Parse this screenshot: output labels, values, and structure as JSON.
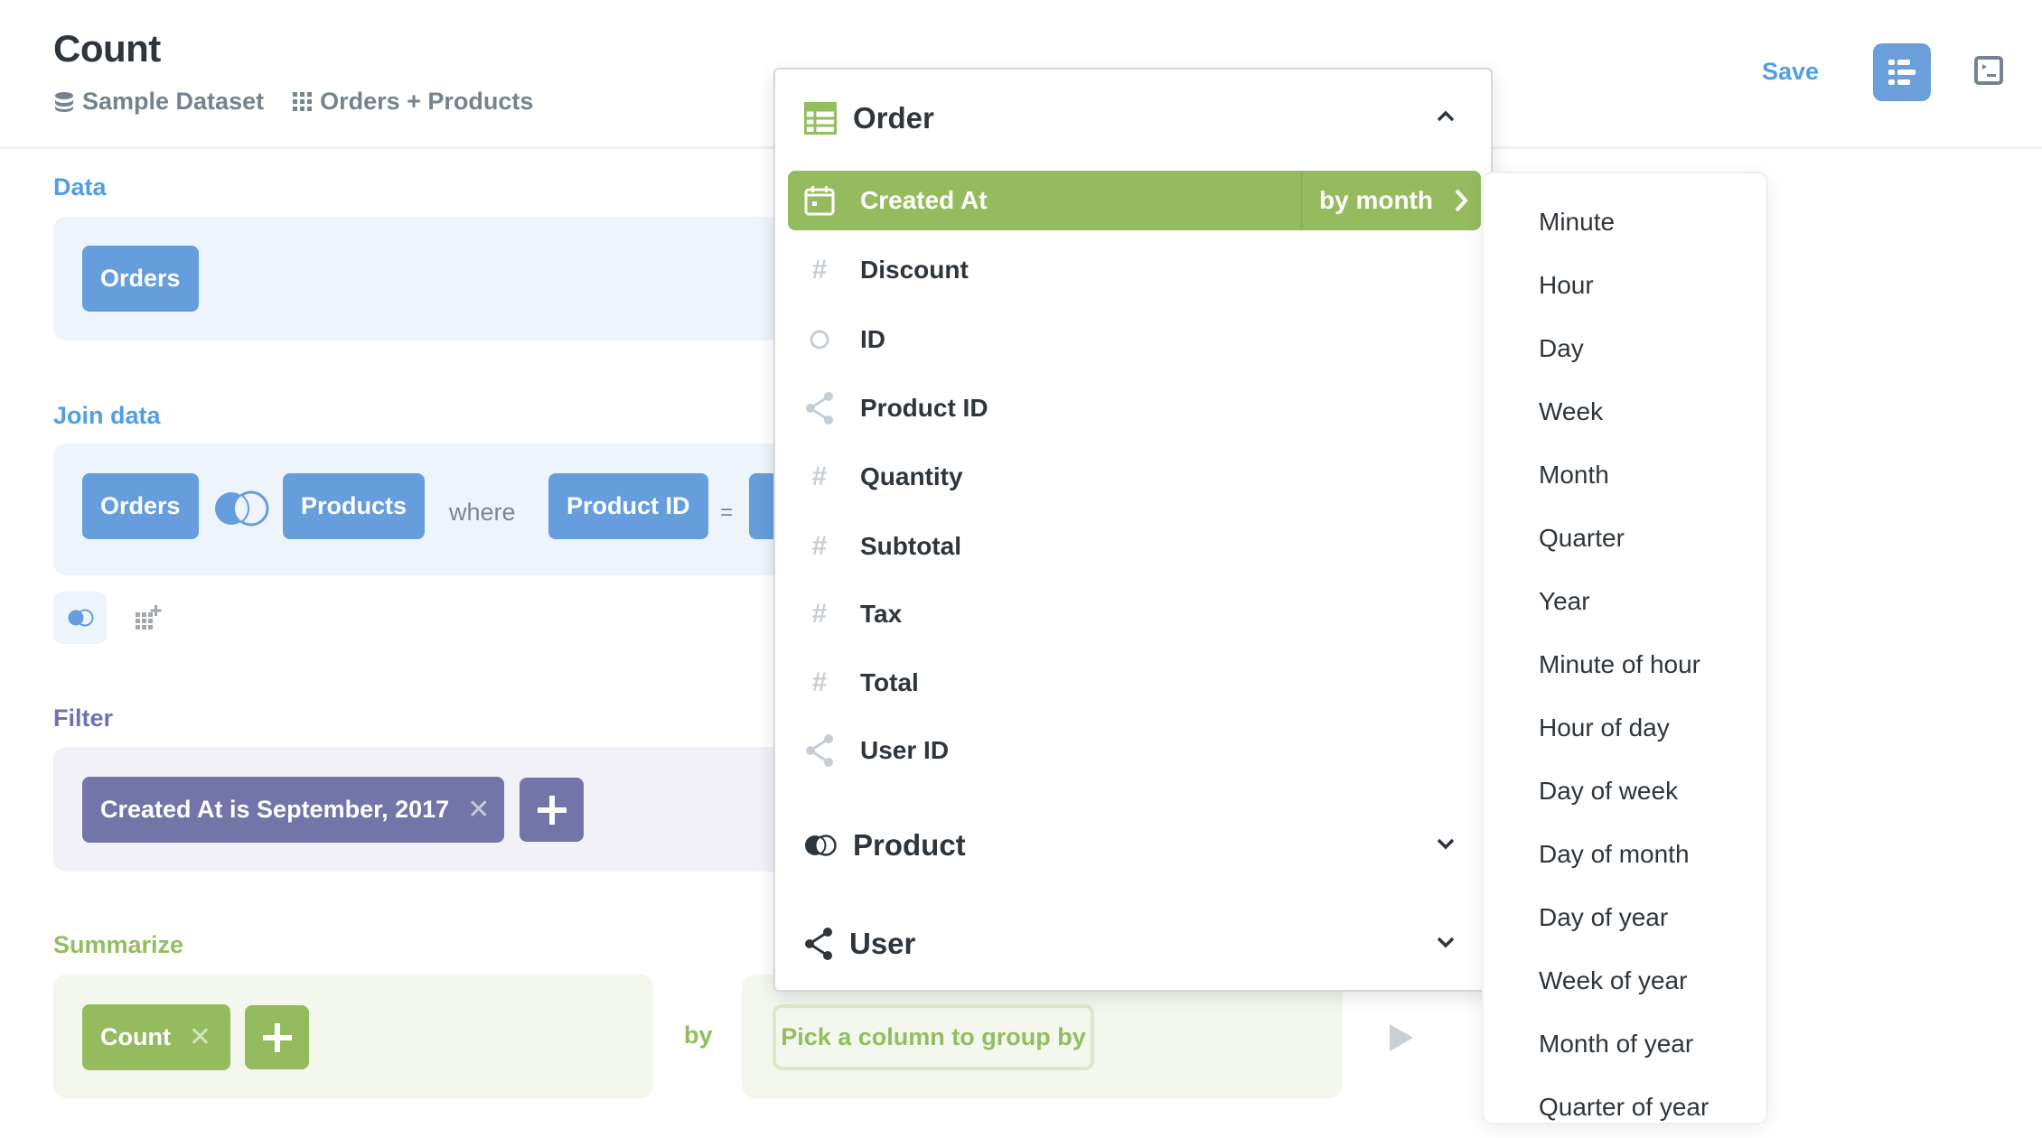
{
  "header": {
    "title": "Count",
    "database": "Sample Dataset",
    "table": "Orders + Products",
    "save_label": "Save",
    "icons": {
      "database": "database-icon",
      "table": "table-grid-icon",
      "notebook": "notebook-icon",
      "sql": "terminal-icon"
    }
  },
  "data_section": {
    "label": "Data",
    "source_table": "Orders"
  },
  "join_section": {
    "label": "Join data",
    "left_table": "Orders",
    "join_type_icon": "left-join-icon",
    "right_table": "Products",
    "where_text": "where",
    "left_column": "Product ID",
    "operator": "="
  },
  "filter_section": {
    "label": "Filter",
    "filters": [
      {
        "text": "Created At is September, 2017",
        "remove": "✕"
      }
    ],
    "add_icon": "plus-icon"
  },
  "summarize_section": {
    "label": "Summarize",
    "metrics": [
      {
        "text": "Count",
        "remove": "✕"
      }
    ],
    "by_text": "by",
    "group_placeholder": "Pick a column to group by"
  },
  "column_picker": {
    "sections": [
      {
        "name": "Order",
        "icon": "table-icon",
        "expanded": true,
        "columns": [
          {
            "name": "Created At",
            "icon": "calendar-icon",
            "selected": true,
            "bucket": "by month"
          },
          {
            "name": "Discount",
            "icon": "number-icon",
            "glyph": "#"
          },
          {
            "name": "ID",
            "icon": "id-icon"
          },
          {
            "name": "Product ID",
            "icon": "foreign-key-icon"
          },
          {
            "name": "Quantity",
            "icon": "number-icon",
            "glyph": "#"
          },
          {
            "name": "Subtotal",
            "icon": "number-icon",
            "glyph": "#"
          },
          {
            "name": "Tax",
            "icon": "number-icon",
            "glyph": "#"
          },
          {
            "name": "Total",
            "icon": "number-icon",
            "glyph": "#"
          },
          {
            "name": "User ID",
            "icon": "foreign-key-icon"
          }
        ]
      },
      {
        "name": "Product",
        "icon": "join-icon",
        "expanded": false
      },
      {
        "name": "User",
        "icon": "connections-icon",
        "expanded": false
      }
    ]
  },
  "temporal_buckets": [
    "Minute",
    "Hour",
    "Day",
    "Week",
    "Month",
    "Quarter",
    "Year",
    "Minute of hour",
    "Hour of day",
    "Day of week",
    "Day of month",
    "Day of year",
    "Week of year",
    "Month of year",
    "Quarter of year"
  ],
  "colors": {
    "brand_blue": "#509ee3",
    "data_pill": "#659ddd",
    "filter_pill": "#7374a8",
    "summarize_pill": "#95bb5f",
    "text_dark": "#2e353b",
    "text_muted": "#74838f"
  }
}
